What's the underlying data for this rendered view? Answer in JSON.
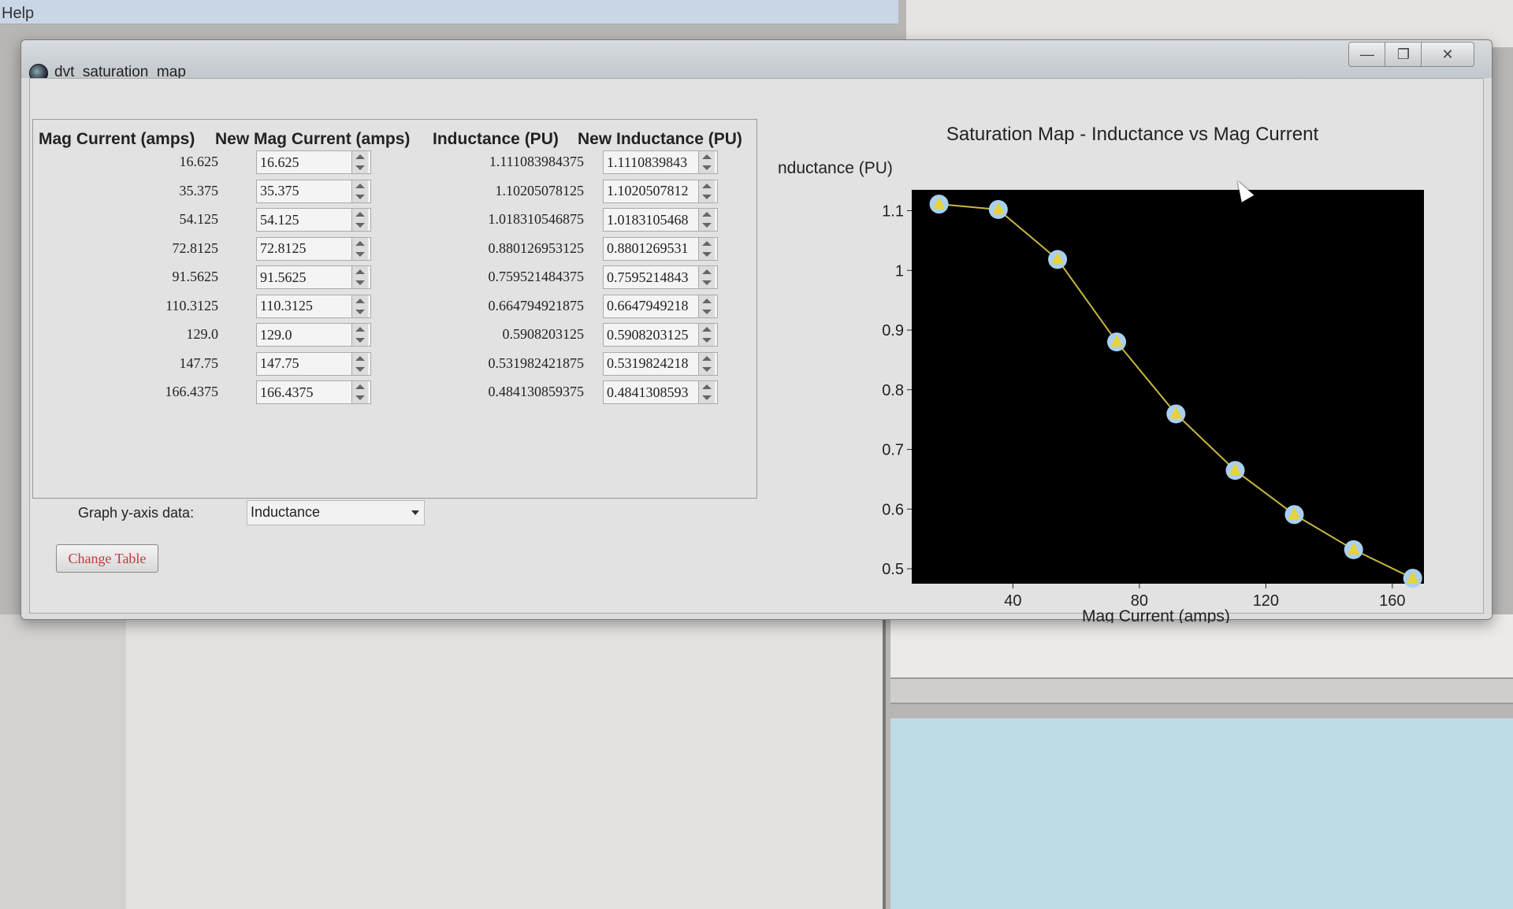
{
  "background": {
    "menu_help": "Help"
  },
  "window": {
    "title": "dvt_saturation_map",
    "min": "—",
    "max": "❐",
    "close": "✕"
  },
  "table": {
    "headers": [
      "Mag Current (amps)",
      "New Mag Current (amps)",
      "Inductance (PU)",
      "New Inductance (PU)"
    ],
    "rows": [
      {
        "mag": "16.625",
        "new_mag": "16.625",
        "ind": "1.111083984375",
        "new_ind": "1.1110839843"
      },
      {
        "mag": "35.375",
        "new_mag": "35.375",
        "ind": "1.10205078125",
        "new_ind": "1.1020507812"
      },
      {
        "mag": "54.125",
        "new_mag": "54.125",
        "ind": "1.018310546875",
        "new_ind": "1.0183105468"
      },
      {
        "mag": "72.8125",
        "new_mag": "72.8125",
        "ind": "0.880126953125",
        "new_ind": "0.8801269531"
      },
      {
        "mag": "91.5625",
        "new_mag": "91.5625",
        "ind": "0.759521484375",
        "new_ind": "0.7595214843"
      },
      {
        "mag": "110.3125",
        "new_mag": "110.3125",
        "ind": "0.664794921875",
        "new_ind": "0.6647949218"
      },
      {
        "mag": "129.0",
        "new_mag": "129.0",
        "ind": "0.5908203125",
        "new_ind": "0.5908203125"
      },
      {
        "mag": "147.75",
        "new_mag": "147.75",
        "ind": "0.531982421875",
        "new_ind": "0.5319824218"
      },
      {
        "mag": "166.4375",
        "new_mag": "166.4375",
        "ind": "0.484130859375",
        "new_ind": "0.4841308593"
      }
    ]
  },
  "controls": {
    "graph_label": "Graph y-axis data:",
    "graph_select": "Inductance",
    "change_button": "Change Table"
  },
  "chart_data": {
    "type": "line",
    "title": "Saturation Map - Inductance vs Mag Current",
    "xlabel": "Mag Current (amps)",
    "ylabel": "Inductance (PU)",
    "x": [
      16.625,
      35.375,
      54.125,
      72.8125,
      91.5625,
      110.3125,
      129.0,
      147.75,
      166.4375
    ],
    "series": [
      {
        "values": [
          1.111083984375,
          1.10205078125,
          1.018310546875,
          0.880126953125,
          0.759521484375,
          0.664794921875,
          0.5908203125,
          0.531982421875,
          0.484130859375
        ]
      }
    ],
    "xlim": [
      8,
      170
    ],
    "ylim": [
      0.475,
      1.135
    ],
    "xticks": [
      40,
      80,
      120,
      160
    ],
    "yticks": [
      0.5,
      0.6,
      0.7,
      0.8,
      0.9,
      1,
      1.1
    ],
    "ytick_labels": [
      "0.5",
      "0.6",
      "0.7",
      "0.8",
      "0.9",
      "1",
      "1.1"
    ],
    "background": "#000000",
    "line_color": "#c9b642",
    "marker_fill": "#e7d23a",
    "marker_ring": "#a9d0ef",
    "grid": false
  }
}
